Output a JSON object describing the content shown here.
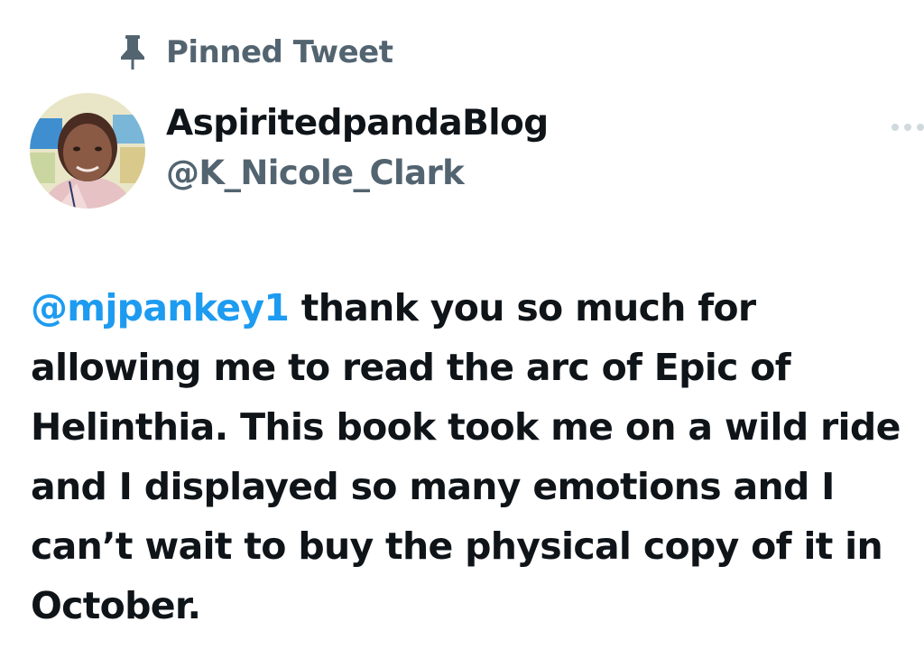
{
  "pinned": {
    "label": "Pinned Tweet",
    "icon": "pin-icon"
  },
  "author": {
    "display_name": "AspiritedpandaBlog",
    "handle": "@K_Nicole_Clark",
    "avatar": "avatar"
  },
  "more_menu": {
    "icon": "more-horizontal-icon"
  },
  "tweet": {
    "mention": "@mjpankey1",
    "lines": [
      " thank you so much for",
      "allowing me to read the arc of Epic of",
      "Helinthia. This book took me on a wild ride",
      "and I displayed so many emotions and I",
      "can’t wait to buy the physical copy of it in",
      "October."
    ]
  },
  "colors": {
    "text_primary": "#0f1419",
    "text_secondary": "#536471",
    "link": "#1d9bf0",
    "background": "#ffffff"
  }
}
